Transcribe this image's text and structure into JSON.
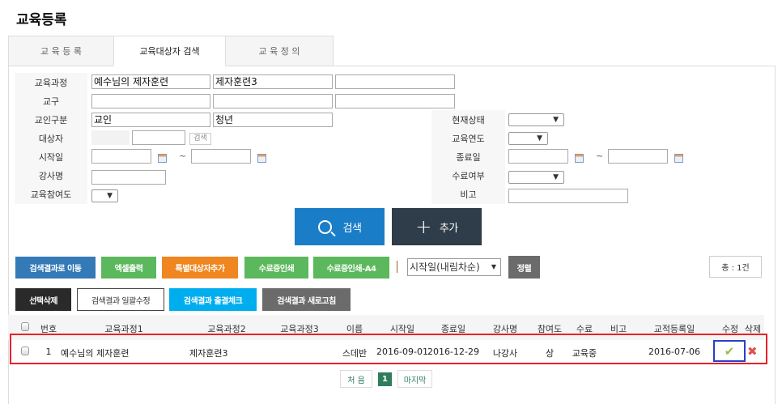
{
  "title": "교육등록",
  "tabs": [
    "교 육 등 록",
    "교육대상자 검색",
    "교 육 정 의"
  ],
  "form": {
    "labels": {
      "course": "교육과정",
      "parish": "교구",
      "member_type": "교인구분",
      "target": "대상자",
      "start_date": "시작일",
      "instructor": "강사명",
      "participation": "교육참여도",
      "status": "현재상태",
      "year": "교육연도",
      "end_date": "종료일",
      "completion": "수료여부",
      "note": "비고"
    },
    "course_values": [
      "예수님의 제자훈련",
      "제자훈련3",
      ""
    ],
    "member_type_values": [
      "교인",
      "청년"
    ],
    "target_search_label": "검색",
    "tilde": "~",
    "select_arrow": "▼"
  },
  "actions": {
    "search": "검색",
    "add": "추가"
  },
  "toolbar1": {
    "move": "검색결과로 이동",
    "excel": "엑셀출력",
    "special": "특별대상자추가",
    "cert": "수료증인쇄",
    "cert_a4": "수료증인쇄-A4",
    "sort_select": "시작일(내림차순)",
    "sort": "정렬",
    "total": "총 : 1건"
  },
  "toolbar2": {
    "delete": "선택삭제",
    "bulk_edit": "검색결과 일괄수정",
    "attendance": "검색결과 출결체크",
    "refresh": "검색결과 새로고침"
  },
  "table": {
    "headers": [
      "번호",
      "교육과정1",
      "교육과정2",
      "교육과정3",
      "이름",
      "시작일",
      "종료일",
      "강사명",
      "참여도",
      "수료",
      "비고",
      "교적등록일",
      "수정",
      "삭제"
    ],
    "rows": [
      {
        "no": "1",
        "course1": "예수님의 제자훈련",
        "course2": "제자훈련3",
        "course3": "",
        "name": "스데반",
        "start": "2016-09-01",
        "end": "2016-12-29",
        "instructor": "나강사",
        "participation": "상",
        "completion": "교육중",
        "note": "",
        "registered": "2016-07-06"
      }
    ]
  },
  "pagination": {
    "first": "처 음",
    "current": "1",
    "last": "마지막"
  },
  "colors": {
    "blue": "#1a7dc8",
    "dark": "#2f3d4a",
    "green": "#5cb85c",
    "orange": "#f0861f",
    "cyan": "#00aeef",
    "gray": "#6b6b6b",
    "highlight_red": "#e8202a",
    "highlight_blue": "#2b3fc8"
  }
}
